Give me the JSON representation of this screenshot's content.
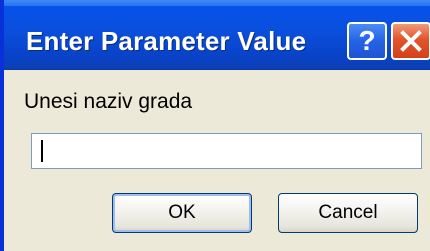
{
  "dialog": {
    "title": "Enter Parameter Value",
    "help_label": "?",
    "prompt_label": "Unesi naziv grada",
    "input_value": "",
    "ok_label": "OK",
    "cancel_label": "Cancel"
  },
  "icons": {
    "help": "help-icon",
    "close": "close-icon"
  },
  "colors": {
    "titlebar": "#0a4fdc",
    "close_button": "#e3542a",
    "dialog_background": "#ece9d8"
  }
}
